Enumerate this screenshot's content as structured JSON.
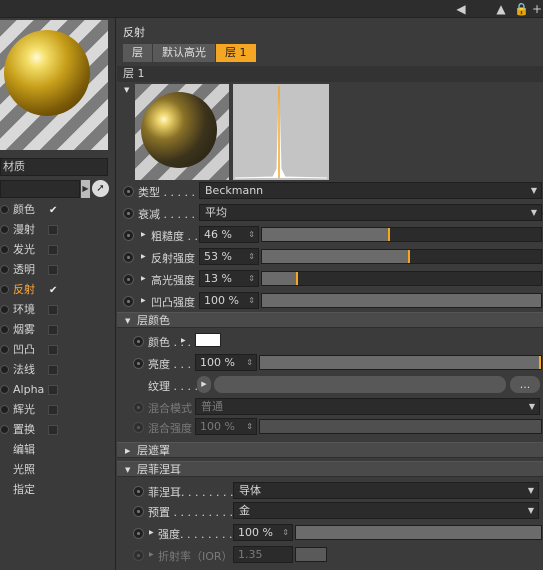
{
  "toolbar": {
    "icons": [
      "arrow-back-icon",
      "arrow-up-icon",
      "lock-icon",
      "plus-icon"
    ]
  },
  "left": {
    "material_name": "材质",
    "search_value": "",
    "channels": [
      {
        "label": "颜色",
        "checked": true
      },
      {
        "label": "漫射",
        "checked": false
      },
      {
        "label": "发光",
        "checked": false
      },
      {
        "label": "透明",
        "checked": false
      },
      {
        "label": "反射",
        "checked": true,
        "active": true
      },
      {
        "label": "环境",
        "checked": false
      },
      {
        "label": "烟雾",
        "checked": false
      },
      {
        "label": "凹凸",
        "checked": false
      },
      {
        "label": "法线",
        "checked": false
      },
      {
        "label": "Alpha",
        "checked": false
      },
      {
        "label": "辉光",
        "checked": false
      },
      {
        "label": "置换",
        "checked": false
      }
    ],
    "extra": [
      "编辑",
      "光照",
      "指定"
    ]
  },
  "right": {
    "section_title": "反射",
    "tabs": [
      "层",
      "默认高光",
      "层 1"
    ],
    "layer_header": "层 1",
    "props": {
      "type_label": "类型 . . . . .",
      "type_value": "Beckmann",
      "attenuation_label": "衰减 . . . . .",
      "attenuation_value": "平均",
      "roughness_label": "粗糙度 . . .",
      "roughness_value": "46 %",
      "refl_strength_label": "反射强度",
      "refl_strength_value": "53 %",
      "spec_strength_label": "高光强度",
      "spec_strength_value": "13 %",
      "bump_strength_label": "凹凸强度",
      "bump_strength_value": "100 %"
    },
    "layer_color": {
      "group_label": "层颜色",
      "color_label": "颜色 . . . .",
      "brightness_label": "亮度 . . . .",
      "brightness_value": "100 %",
      "texture_label": "纹理 . . . .",
      "texture_more": "...",
      "blend_mode_label": "混合模式",
      "blend_mode_value": "普通",
      "blend_strength_label": "混合强度",
      "blend_strength_value": "100 %"
    },
    "layer_mask": {
      "group_label": "层遮罩"
    },
    "layer_fresnel": {
      "group_label": "层菲涅耳",
      "fresnel_label": "菲涅耳. . . . . . . . .",
      "fresnel_value": "导体",
      "preset_label": "预置 . . . . . . . . . .",
      "preset_value": "金",
      "strength_label": "强度. . . . . . . .",
      "strength_value": "100 %",
      "ior_label": "折射率（IOR）",
      "ior_value": "1.35"
    },
    "levels": {
      "roughness": 0.46,
      "refl_strength": 0.53,
      "spec_strength": 0.13,
      "bump_strength": 1.0,
      "brightness": 1.0,
      "blend_strength": 1.0,
      "strength": 1.0
    }
  }
}
